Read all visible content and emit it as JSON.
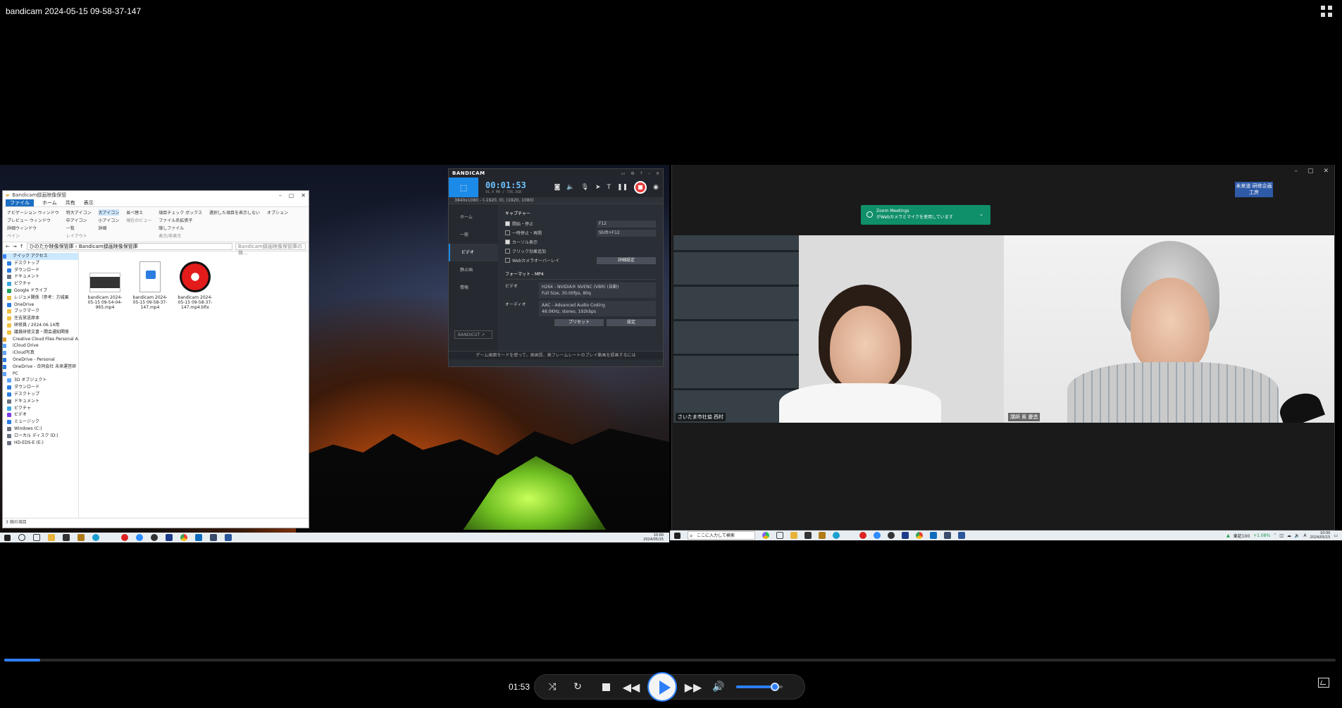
{
  "player": {
    "title": "bandicam 2024-05-15 09-58-37-147",
    "current_time": "01:53",
    "progress": 0.027,
    "volume": 0.83
  },
  "explorer": {
    "title": "Bandicam録画映像保管",
    "menu": [
      "ファイル",
      "ホーム",
      "共有",
      "表示"
    ],
    "ribbon": {
      "pane_labels": [
        "ナビゲーション ウィンドウ",
        "プレビュー ウィンドウ",
        "詳細ウィンドウ"
      ],
      "layout": [
        "特大アイコン",
        "大アイコン",
        "中アイコン",
        "小アイコン",
        "一覧",
        "詳細"
      ],
      "sort": "並べ替え",
      "checks": [
        "項目チェック ボックス",
        "ファイル名拡張子",
        "隠しファイル"
      ],
      "hide_selected": "選択した項目を表示しない",
      "options": "オプション",
      "group_labels": [
        "ペイン",
        "レイアウト",
        "現在のビュー",
        "表示/非表示"
      ]
    },
    "address": "ひのたか映像保管庫 › Bandicam録画映像保管庫",
    "search_placeholder": "Bandicam録画映像保管庫の検...",
    "nav": [
      {
        "label": "クイック アクセス",
        "top": true,
        "color": "#3b82f6"
      },
      {
        "label": "デスクトップ",
        "color": "#2b7de0"
      },
      {
        "label": "ダウンロード",
        "color": "#2b7de0"
      },
      {
        "label": "ドキュメント",
        "color": "#6b7280"
      },
      {
        "label": "ピクチャ",
        "color": "#3aa6e0"
      },
      {
        "label": "Google ドライブ",
        "color": "#22a35a"
      },
      {
        "label": "レジュメ関係（参考：方城果",
        "color": "#f0c040"
      },
      {
        "label": "OneDrive",
        "color": "#2b7de0"
      },
      {
        "label": "ブックマーク",
        "color": "#f0c040"
      },
      {
        "label": "住吉放送原本",
        "color": "#f0c040"
      },
      {
        "label": "研修員 / 2024.06.14用",
        "color": "#f0c040"
      },
      {
        "label": "議員研修文書・開会通知関係",
        "color": "#f0c040"
      },
      {
        "label": "Creative Cloud Files Personal Ac",
        "top": true,
        "color": "#e0a030"
      },
      {
        "label": "iCloud Drive",
        "top": true,
        "color": "#60a5fa"
      },
      {
        "label": "iCloud写真",
        "top": true,
        "color": "#60a5fa"
      },
      {
        "label": "OneDrive - Personal",
        "top": true,
        "color": "#2b7de0"
      },
      {
        "label": "OneDrive - 合同会社 未来運営研",
        "top": true,
        "color": "#2b7de0"
      },
      {
        "label": "PC",
        "top": true,
        "color": "#60a5fa"
      },
      {
        "label": "3D オブジェクト",
        "color": "#60a5fa"
      },
      {
        "label": "ダウンロード",
        "color": "#2b7de0"
      },
      {
        "label": "デスクトップ",
        "color": "#2b7de0"
      },
      {
        "label": "ドキュメント",
        "color": "#6b7280"
      },
      {
        "label": "ピクチャ",
        "color": "#3aa6e0"
      },
      {
        "label": "ビデオ",
        "color": "#7c3aed"
      },
      {
        "label": "ミュージック",
        "color": "#2b7de0"
      },
      {
        "label": "Windows (C:)",
        "color": "#6b7280"
      },
      {
        "label": "ローカル ディスク (D:)",
        "color": "#6b7280"
      },
      {
        "label": "HD-EDS-E (E:)",
        "color": "#6b7280"
      }
    ],
    "files": [
      {
        "name": "bandicam 2024-05-15 09-54-04-965.mp4",
        "kind": "video-thumb"
      },
      {
        "name": "bandicam 2024-05-15 09-58-37-147.mp4",
        "kind": "mp4"
      },
      {
        "name": "bandicam 2024-05-15 09-58-37-147.mp4.bfix",
        "kind": "bfix"
      }
    ],
    "status": "3 個の項目"
  },
  "bandicam": {
    "logo": "BANDICAM",
    "timer": "00:01:53",
    "timer_sub": "91.4 MB / 736.3GB",
    "resolution": "3840x1080 - (-1920, 0), (1920, 1080)",
    "nav": [
      "ホーム",
      "一般",
      "ビデオ",
      "静止画",
      "情報"
    ],
    "active_nav": "ビデオ",
    "bandicut": "BANDICUT ↗",
    "capture_header": "キャプチャー",
    "options": [
      {
        "label": "開始・停止",
        "on": true,
        "value": "F12"
      },
      {
        "label": "一時停止・再開",
        "on": false,
        "value": "Shift+F12"
      },
      {
        "label": "カーソル表示",
        "on": true,
        "value": ""
      },
      {
        "label": "クリック効果追加",
        "on": false,
        "value": ""
      },
      {
        "label": "Webカメラオーバーレイ",
        "on": false,
        "value": ""
      }
    ],
    "detail_button": "詳細設定",
    "format_header": "フォーマット - MP4",
    "video_label": "ビデオ",
    "video_value": "H264 - NVIDIA® NVENC (VBR) (自動)",
    "video_sub": "Full Size, 30.00fps, 80q",
    "audio_label": "オーディオ",
    "audio_value": "AAC - Advanced Audio Coding",
    "audio_sub": "48.0KHz, stereo, 192kbps",
    "preset_button": "プリセット",
    "settings_button": "設定",
    "footer": "ゲーム画面モードを使って、高画質、高フレームレートのプレイ動画を録画するには"
  },
  "zoom": {
    "badge": "未来道 研修企画工房",
    "toast_title": "Zoom Meetings",
    "toast_text": "がWebカメラとマイクを使用しています",
    "participants": [
      {
        "name": "さいたま市社協 西村"
      },
      {
        "name": "講師 奥 慶造"
      }
    ]
  },
  "taskbar": {
    "left_clock": "10:00\n2024/05/15",
    "search_placeholder": "ここに入力して検索",
    "weather": "東証100",
    "weather_change": "+1.08%",
    "right_clock": "10:00\n2024/05/15",
    "ime": "A"
  },
  "colors": {
    "accent": "#2d7ff9",
    "zoom_toast": "#0f8f6a",
    "bandicam_rec": "#e83d3d"
  }
}
